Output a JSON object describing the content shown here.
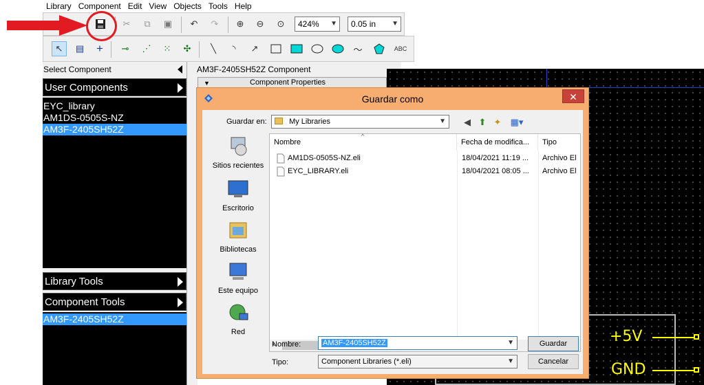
{
  "menu": [
    "Library",
    "Component",
    "Edit",
    "View",
    "Objects",
    "Tools",
    "Help"
  ],
  "toolbar": {
    "zoom_value": "424%",
    "grid_value": "0.05 in",
    "text_tool_label": "ABC"
  },
  "left_panel": {
    "select_component_label": "Select Component",
    "user_components_label": "User Components",
    "user_components": [
      "EYC_library",
      "AM1DS-0505S-NZ",
      "AM3F-2405SH52Z"
    ],
    "selected_user_component": "AM3F-2405SH52Z",
    "library_tools_label": "Library Tools",
    "component_tools_label": "Component Tools",
    "component_tools_item": "AM3F-2405SH52Z"
  },
  "editor": {
    "title": "AM3F-2405SH52Z Component",
    "properties_label": "Component Properties",
    "pins": [
      "+5V",
      "GND"
    ]
  },
  "dialog": {
    "title": "Guardar como",
    "close_label": "✕",
    "save_in_label": "Guardar en:",
    "save_in_value": "My Libraries",
    "places": [
      "Sitios recientes",
      "Escritorio",
      "Bibliotecas",
      "Este equipo",
      "Red"
    ],
    "columns": [
      "Nombre",
      "Fecha de modifica...",
      "Tipo"
    ],
    "files": [
      {
        "name": "AM1DS-0505S-NZ.eli",
        "date": "18/04/2021 11:19 ...",
        "type": "Archivo El"
      },
      {
        "name": "EYC_LIBRARY.eli",
        "date": "18/04/2021 08:05 ...",
        "type": "Archivo El"
      }
    ],
    "filename_label": "Nombre:",
    "filename_value": "AM3F-2405SH52Z",
    "filetype_label": "Tipo:",
    "filetype_value": "Component Libraries (*.eli)",
    "save_button": "Guardar",
    "cancel_button": "Cancelar"
  },
  "colors": {
    "annotation_red": "#e21b23",
    "dialog_frame": "#f6ad6f",
    "selection_blue": "#3399ff",
    "pin_yellow": "#ffff00"
  }
}
